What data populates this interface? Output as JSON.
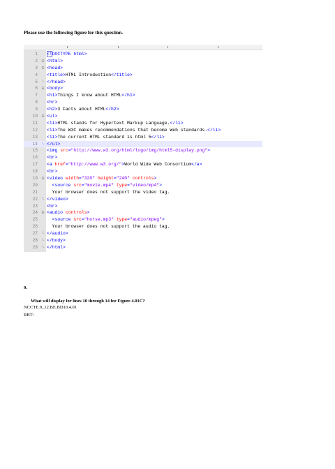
{
  "intro": "Please use the following figure for this question.",
  "code_lines": [
    {
      "n": "1",
      "fold": "",
      "tokens": [
        {
          "c": "tag",
          "t": "<!DOCTYPE html>"
        }
      ]
    },
    {
      "n": "2",
      "fold": "⊟",
      "tokens": [
        {
          "c": "tag",
          "t": "<html>"
        }
      ]
    },
    {
      "n": "3",
      "fold": "⊟",
      "tokens": [
        {
          "c": "tag",
          "t": "<head>"
        }
      ]
    },
    {
      "n": "4",
      "fold": "",
      "tokens": [
        {
          "c": "tag",
          "t": "<title>"
        },
        {
          "c": "txt",
          "t": "HTML Introduction"
        },
        {
          "c": "tag",
          "t": "</title>"
        }
      ]
    },
    {
      "n": "5",
      "fold": "└",
      "tokens": [
        {
          "c": "tag",
          "t": "</head>"
        }
      ]
    },
    {
      "n": "6",
      "fold": "⊟",
      "tokens": [
        {
          "c": "tag",
          "t": "<body>"
        }
      ]
    },
    {
      "n": "7",
      "fold": "",
      "tokens": [
        {
          "c": "tag",
          "t": "<h1>"
        },
        {
          "c": "txt",
          "t": "Things I know about HTML"
        },
        {
          "c": "tag",
          "t": "</h1>"
        }
      ]
    },
    {
      "n": "8",
      "fold": "",
      "tokens": [
        {
          "c": "tag",
          "t": "<hr>"
        }
      ]
    },
    {
      "n": "9",
      "fold": "",
      "tokens": [
        {
          "c": "tag",
          "t": "<h2>"
        },
        {
          "c": "txt",
          "t": "3 Facts about HTML"
        },
        {
          "c": "tag",
          "t": "</h2>"
        }
      ]
    },
    {
      "n": "10",
      "fold": "⊟",
      "tokens": [
        {
          "c": "tag",
          "t": "<ul>"
        }
      ]
    },
    {
      "n": "11",
      "fold": "",
      "tokens": [
        {
          "c": "tag",
          "t": "<li>"
        },
        {
          "c": "txt",
          "t": "HTML stands for Hypertext Markup Language."
        },
        {
          "c": "tag",
          "t": "</li>"
        }
      ]
    },
    {
      "n": "12",
      "fold": "",
      "tokens": [
        {
          "c": "tag",
          "t": "<li>"
        },
        {
          "c": "txt",
          "t": "The W3C makes recommendations that become Web standards."
        },
        {
          "c": "tag",
          "t": "</li>"
        }
      ]
    },
    {
      "n": "13",
      "fold": "",
      "tokens": [
        {
          "c": "tag",
          "t": "<li>"
        },
        {
          "c": "txt",
          "t": "The current HTML standard is html 5"
        },
        {
          "c": "tag",
          "t": "</li>"
        }
      ]
    },
    {
      "n": "14",
      "fold": "└",
      "tokens": [
        {
          "c": "tag",
          "t": "</ul>"
        }
      ]
    },
    {
      "n": "15",
      "fold": "",
      "tokens": [
        {
          "c": "tag",
          "t": "<img "
        },
        {
          "c": "attr",
          "t": "src"
        },
        {
          "c": "tag",
          "t": "="
        },
        {
          "c": "str",
          "t": "\"http://www.w3.org/html/logo/img/html5-display.png\""
        },
        {
          "c": "tag",
          "t": ">"
        }
      ]
    },
    {
      "n": "16",
      "fold": "",
      "tokens": [
        {
          "c": "tag",
          "t": "<br>"
        }
      ]
    },
    {
      "n": "17",
      "fold": "",
      "tokens": [
        {
          "c": "tag",
          "t": "<a "
        },
        {
          "c": "attr",
          "t": "href"
        },
        {
          "c": "tag",
          "t": "="
        },
        {
          "c": "str",
          "t": "\"http://www.w3.org/\""
        },
        {
          "c": "tag",
          "t": ">"
        },
        {
          "c": "txt",
          "t": "World Wide Web Consortium"
        },
        {
          "c": "tag",
          "t": "</a>"
        }
      ]
    },
    {
      "n": "18",
      "fold": "",
      "tokens": [
        {
          "c": "tag",
          "t": "<br>"
        }
      ]
    },
    {
      "n": "19",
      "fold": "⊟",
      "tokens": [
        {
          "c": "tag",
          "t": "<video "
        },
        {
          "c": "attr",
          "t": "width"
        },
        {
          "c": "tag",
          "t": "="
        },
        {
          "c": "str",
          "t": "\"320\""
        },
        {
          "c": "tag",
          "t": " "
        },
        {
          "c": "attr",
          "t": "height"
        },
        {
          "c": "tag",
          "t": "="
        },
        {
          "c": "str",
          "t": "\"240\""
        },
        {
          "c": "tag",
          "t": " "
        },
        {
          "c": "attr",
          "t": "controls"
        },
        {
          "c": "tag",
          "t": ">"
        }
      ]
    },
    {
      "n": "20",
      "fold": "",
      "tokens": [
        {
          "c": "txt",
          "t": "  "
        },
        {
          "c": "tag",
          "t": "<source "
        },
        {
          "c": "attr",
          "t": "src"
        },
        {
          "c": "tag",
          "t": "="
        },
        {
          "c": "str",
          "t": "\"movie.mp4\""
        },
        {
          "c": "tag",
          "t": " "
        },
        {
          "c": "attr",
          "t": "type"
        },
        {
          "c": "tag",
          "t": "="
        },
        {
          "c": "str",
          "t": "\"video/mp4\""
        },
        {
          "c": "tag",
          "t": ">"
        }
      ]
    },
    {
      "n": "21",
      "fold": "",
      "tokens": [
        {
          "c": "txt",
          "t": "  Your browser does not support the video tag."
        }
      ]
    },
    {
      "n": "22",
      "fold": "└",
      "tokens": [
        {
          "c": "tag",
          "t": "</video>"
        }
      ]
    },
    {
      "n": "23",
      "fold": "",
      "tokens": [
        {
          "c": "tag",
          "t": "<br>"
        }
      ]
    },
    {
      "n": "24",
      "fold": "⊟",
      "tokens": [
        {
          "c": "tag",
          "t": "<audio "
        },
        {
          "c": "attr",
          "t": "controls"
        },
        {
          "c": "tag",
          "t": ">"
        }
      ]
    },
    {
      "n": "25",
      "fold": "",
      "tokens": [
        {
          "c": "txt",
          "t": "  "
        },
        {
          "c": "tag",
          "t": "<source "
        },
        {
          "c": "attr",
          "t": "src"
        },
        {
          "c": "tag",
          "t": "="
        },
        {
          "c": "str",
          "t": "\"horse.mp3\""
        },
        {
          "c": "tag",
          "t": " "
        },
        {
          "c": "attr",
          "t": "type"
        },
        {
          "c": "tag",
          "t": "="
        },
        {
          "c": "str",
          "t": "\"audio/mpeg\""
        },
        {
          "c": "tag",
          "t": ">"
        }
      ]
    },
    {
      "n": "26",
      "fold": "",
      "tokens": [
        {
          "c": "txt",
          "t": "  Your browser does not support the audio tag."
        }
      ]
    },
    {
      "n": "27",
      "fold": "└",
      "tokens": [
        {
          "c": "tag",
          "t": "</audio>"
        }
      ]
    },
    {
      "n": "28",
      "fold": "└",
      "tokens": [
        {
          "c": "tag",
          "t": "</body>"
        }
      ]
    },
    {
      "n": "29",
      "fold": "└",
      "tokens": [
        {
          "c": "tag",
          "t": "</html>"
        }
      ]
    }
  ],
  "highlighted_line": "14",
  "question_number": "9.",
  "question_text": "What will display for lines 10 through 14 for Figure 4.01C?",
  "standard_code": "NCCTE.9_12.BE.BD10.4.01",
  "rbt_label": "RBT:"
}
